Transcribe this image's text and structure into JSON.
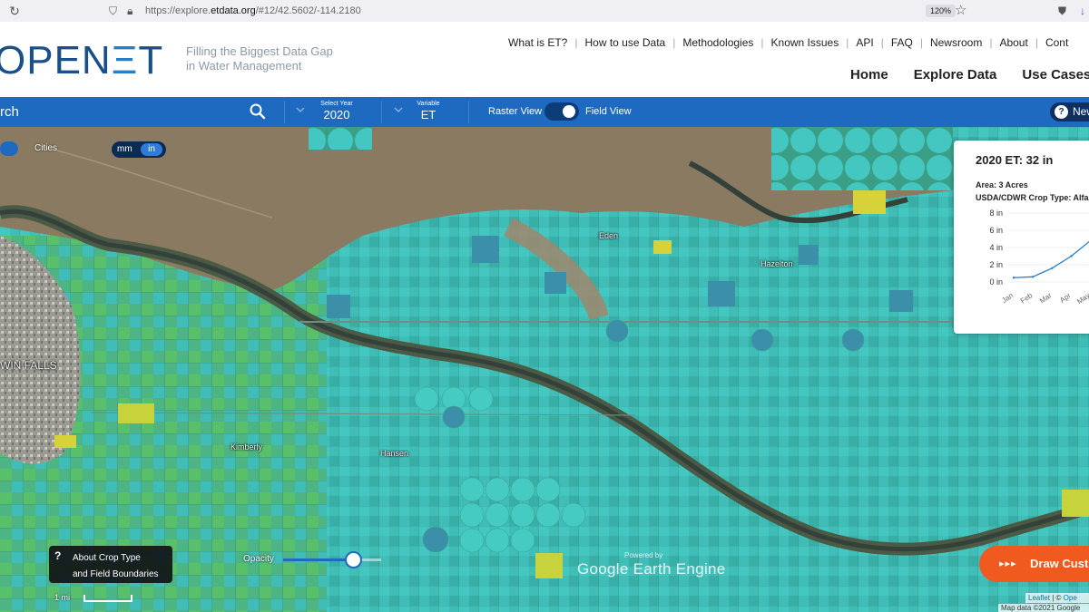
{
  "browser": {
    "url_prefix": "https://explore.",
    "url_domain": "etdata.org",
    "url_rest": "/#12/42.5602/-114.2180",
    "zoom": "120%"
  },
  "header": {
    "logo_open": "OPEN",
    "logo_e": "Ξ",
    "logo_t": "T",
    "tagline_line1": "Filling the Biggest Data Gap",
    "tagline_line2": "in Water Management",
    "top_links": [
      "What is ET?",
      "How to use Data",
      "Methodologies",
      "Known Issues",
      "API",
      "FAQ",
      "Newsroom",
      "About",
      "Cont"
    ],
    "main_nav": [
      "Home",
      "Explore Data",
      "Use Cases"
    ]
  },
  "toolbar": {
    "search_label": "rch",
    "year_label": "Select Year",
    "year_value": "2020",
    "variable_label": "Variable",
    "variable_value": "ET",
    "raster_label": "Raster View",
    "field_label": "Field View",
    "help_text": "New",
    "colors": {
      "bar": "#1d6ac0",
      "toggle": "#0c3d78"
    }
  },
  "map": {
    "cities_label": "Cities",
    "unit_mm": "mm",
    "unit_in": "in",
    "places": {
      "twin_falls": "WIN FALLS",
      "kimberly": "Kimberly",
      "hansen": "Hansen",
      "eden": "Eden",
      "hazelton": "Hazelton"
    },
    "colors": {
      "field_teal": "#3ec4be",
      "field_green": "#4fb37a",
      "field_yellow": "#d8d23a",
      "desert": "#8a7a62",
      "river": "#3d4a40"
    }
  },
  "popup": {
    "title": "2020 ET: 32 in",
    "area": "Area: 3 Acres",
    "crop": "USDA/CDWR Crop Type: Alfa",
    "y_ticks": [
      "8 in",
      "6 in",
      "4 in",
      "2 in",
      "0 in"
    ],
    "x_ticks": [
      "Jan",
      "Feb",
      "Mar",
      "Apr",
      "May"
    ],
    "line_color": "#2a7ec4"
  },
  "chart_data": {
    "type": "line",
    "title": "2020 ET: 32 in",
    "categories": [
      "Jan",
      "Feb",
      "Mar",
      "Apr",
      "May"
    ],
    "values": [
      0.5,
      0.6,
      1.6,
      3.0,
      4.8
    ],
    "xlabel": "",
    "ylabel": "",
    "ylim": [
      0,
      8
    ]
  },
  "controls": {
    "about_q": "?",
    "about_line1": "About Crop Type",
    "about_line2": "and Field Boundaries",
    "opacity_label": "Opacity",
    "opacity_value": 0.78,
    "gee_powered": "Powered by",
    "gee_logo": "Google Earth Engine",
    "scale_label": "1 mi",
    "draw_arrows": "▸▸▸",
    "draw_label": "Draw Cust",
    "attrib_leaflet": "Leaflet",
    "attrib_sep": " | © ",
    "attrib_ope": "Ope",
    "attrib_mapdata": "Map data ©2021 Google"
  }
}
